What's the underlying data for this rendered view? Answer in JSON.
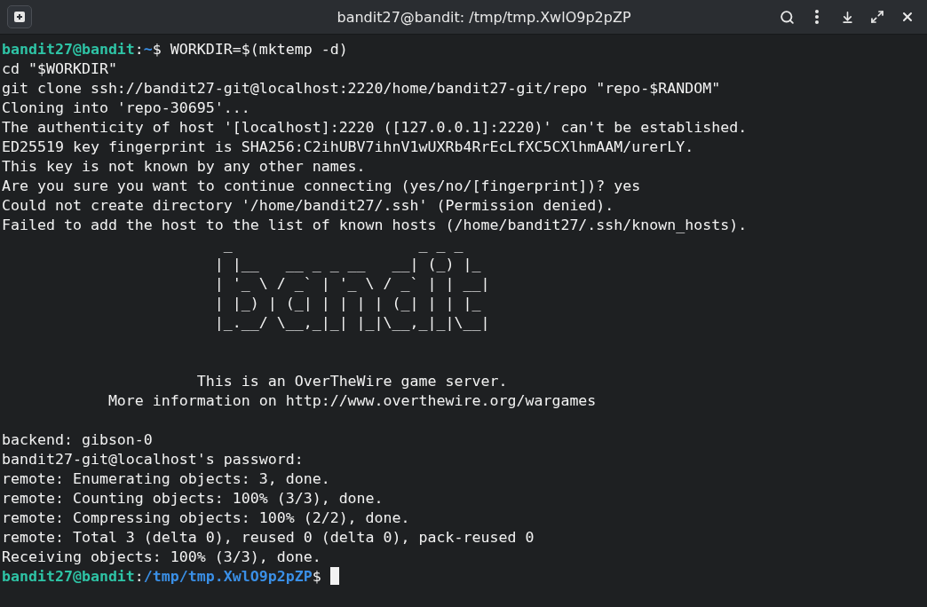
{
  "window": {
    "title": "bandit27@bandit: /tmp/tmp.XwlO9p2pZP"
  },
  "lines": [
    {
      "kind": "prompt",
      "user_host": "bandit27@bandit",
      "separator": ":",
      "path": "~",
      "symbol": "$",
      "command": "WORKDIR=$(mktemp -d)"
    },
    {
      "kind": "output",
      "text": "cd \"$WORKDIR\""
    },
    {
      "kind": "output",
      "text": "git clone ssh://bandit27-git@localhost:2220/home/bandit27-git/repo \"repo-$RANDOM\""
    },
    {
      "kind": "output",
      "text": "Cloning into 'repo-30695'..."
    },
    {
      "kind": "output",
      "text": "The authenticity of host '[localhost]:2220 ([127.0.0.1]:2220)' can't be established."
    },
    {
      "kind": "output",
      "text": "ED25519 key fingerprint is SHA256:C2ihUBV7ihnV1wUXRb4RrEcLfXC5CXlhmAAM/urerLY."
    },
    {
      "kind": "output",
      "text": "This key is not known by any other names."
    },
    {
      "kind": "output",
      "text": "Are you sure you want to continue connecting (yes/no/[fingerprint])? yes"
    },
    {
      "kind": "output",
      "text": "Could not create directory '/home/bandit27/.ssh' (Permission denied)."
    },
    {
      "kind": "output",
      "text": "Failed to add the host to the list of known hosts (/home/bandit27/.ssh/known_hosts)."
    },
    {
      "kind": "output",
      "text": "                         _                     _ _ _"
    },
    {
      "kind": "output",
      "text": "                        | |__   __ _ _ __   __| (_) |_"
    },
    {
      "kind": "output",
      "text": "                        | '_ \\ / _` | '_ \\ / _` | | __|"
    },
    {
      "kind": "output",
      "text": "                        | |_) | (_| | | | | (_| | | |_"
    },
    {
      "kind": "output",
      "text": "                        |_.__/ \\__,_|_| |_|\\__,_|_|\\__|"
    },
    {
      "kind": "blank"
    },
    {
      "kind": "blank"
    },
    {
      "kind": "output",
      "text": "                      This is an OverTheWire game server."
    },
    {
      "kind": "output",
      "text": "            More information on http://www.overthewire.org/wargames"
    },
    {
      "kind": "blank"
    },
    {
      "kind": "output",
      "text": "backend: gibson-0"
    },
    {
      "kind": "output",
      "text": "bandit27-git@localhost's password:"
    },
    {
      "kind": "output",
      "text": "remote: Enumerating objects: 3, done."
    },
    {
      "kind": "output",
      "text": "remote: Counting objects: 100% (3/3), done."
    },
    {
      "kind": "output",
      "text": "remote: Compressing objects: 100% (2/2), done."
    },
    {
      "kind": "output",
      "text": "remote: Total 3 (delta 0), reused 0 (delta 0), pack-reused 0"
    },
    {
      "kind": "output",
      "text": "Receiving objects: 100% (3/3), done."
    },
    {
      "kind": "prompt",
      "user_host": "bandit27@bandit",
      "separator": ":",
      "path": "/tmp/tmp.XwlO9p2pZP",
      "symbol": "$",
      "cursor": true
    }
  ]
}
